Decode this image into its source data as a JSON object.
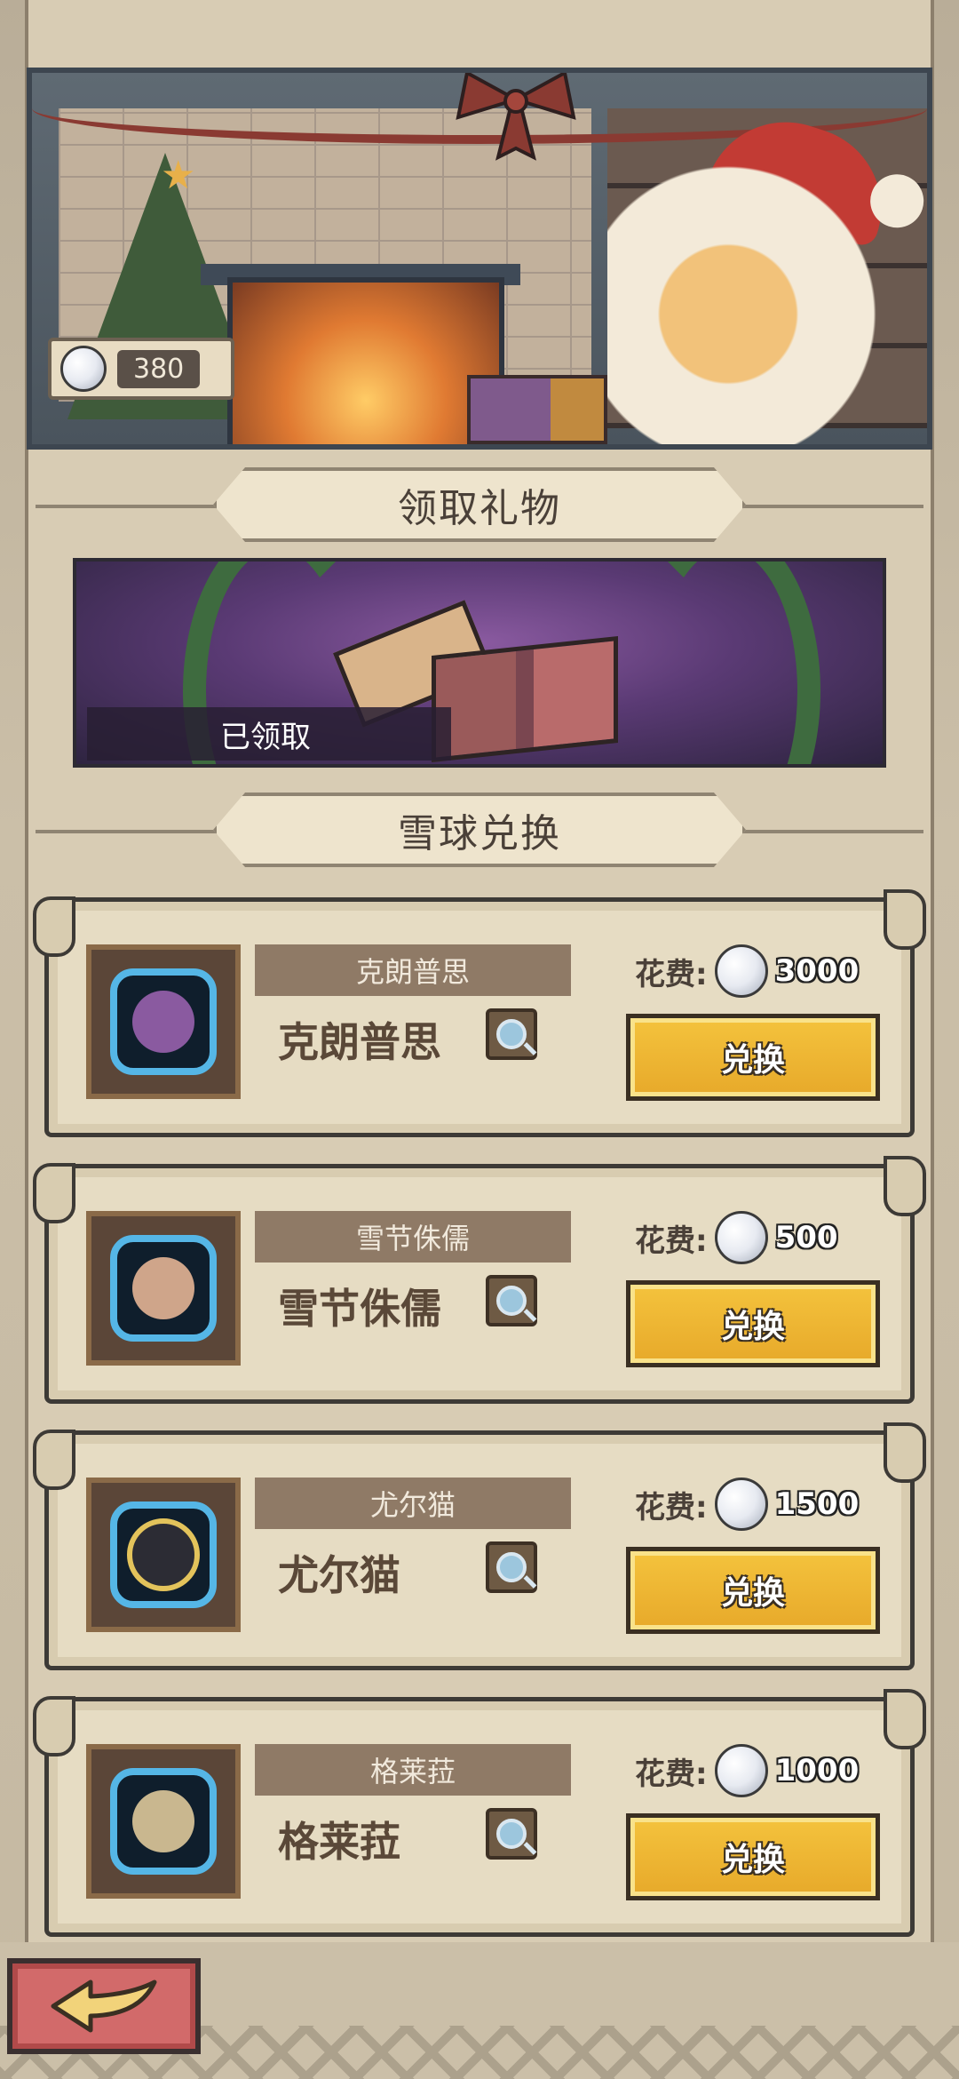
{
  "header": {
    "snowball_balance": "380"
  },
  "sections": {
    "claim_gift_title": "领取礼物",
    "snow_exchange_title": "雪球兑换"
  },
  "gift": {
    "status_label": "已领取"
  },
  "exchange_items": [
    {
      "tag": "克朗普思",
      "name": "克朗普思",
      "cost_label": "花费:",
      "cost": "3000",
      "button": "兑换",
      "emblem_color": "#8a5aa0"
    },
    {
      "tag": "雪节侏儒",
      "name": "雪节侏儒",
      "cost_label": "花费:",
      "cost": "500",
      "button": "兑换",
      "emblem_color": "#cfa58a"
    },
    {
      "tag": "尤尔猫",
      "name": "尤尔猫",
      "cost_label": "花费:",
      "cost": "1500",
      "button": "兑换",
      "emblem_color": "#2c2c34"
    },
    {
      "tag": "格莱菈",
      "name": "格莱菈",
      "cost_label": "花费:",
      "cost": "1000",
      "button": "兑换",
      "emblem_color": "#c9b78f"
    }
  ],
  "icons": {
    "snowball": "snowball-icon",
    "magnifier": "magnifier-icon",
    "back": "back-arrow-icon"
  },
  "colors": {
    "exchange_button": "#f4c33d",
    "back_button": "#d26a6a",
    "emblem_border": "#55b6e6"
  }
}
